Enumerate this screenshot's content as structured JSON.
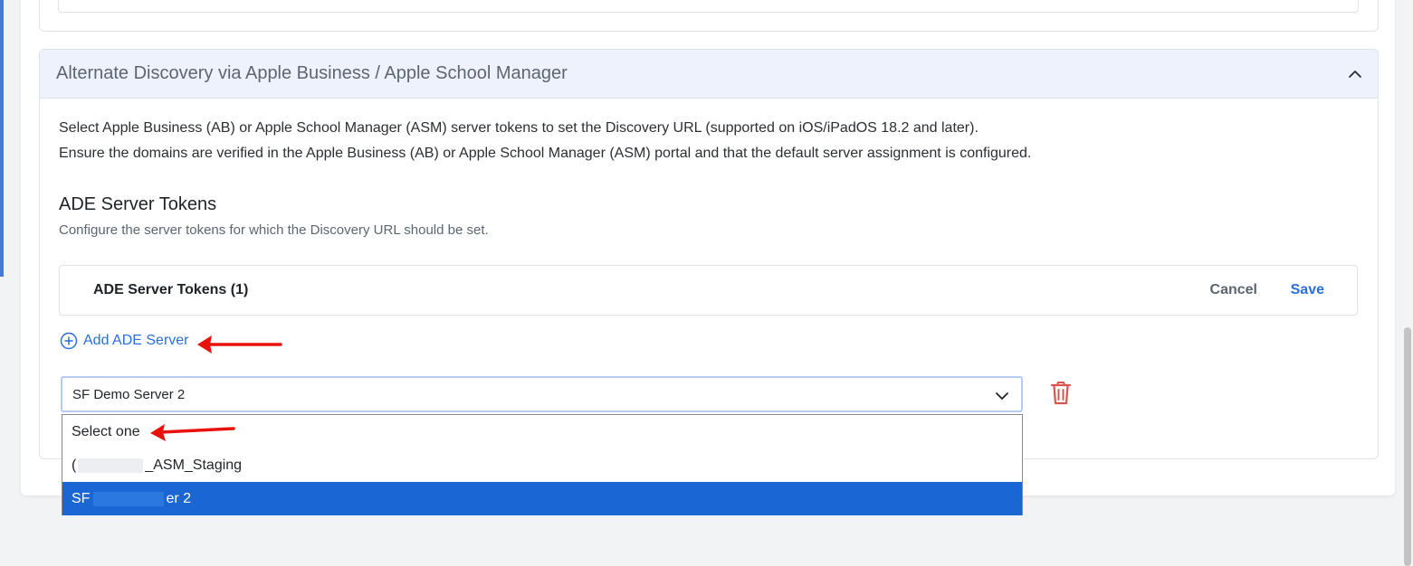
{
  "accordion": {
    "title": "Alternate Discovery via Apple Business / Apple School Manager",
    "description_line1": "Select Apple Business (AB) or Apple School Manager (ASM) server tokens to set the Discovery URL (supported on iOS/iPadOS 18.2 and later).",
    "description_line2": "Ensure the domains are verified in the Apple Business (AB) or Apple School Manager (ASM) portal and that the default server assignment is configured."
  },
  "ade_section": {
    "title": "ADE Server Tokens",
    "subtitle": "Configure the server tokens for which the Discovery URL should be set.",
    "tokens_header": "ADE Server Tokens (1)",
    "cancel_label": "Cancel",
    "save_label": "Save",
    "add_label": "Add ADE Server"
  },
  "select": {
    "value": "SF Demo Server 2",
    "options": [
      {
        "label": "Select one"
      },
      {
        "prefix": "(",
        "suffix": "_ASM_Staging"
      },
      {
        "prefix": "SF",
        "suffix": "er 2"
      }
    ],
    "highlighted_index": 2
  },
  "icons": {
    "accordion_toggle": "chevron-up-icon",
    "select_toggle": "chevron-down-icon",
    "add": "plus-circle-icon",
    "delete": "trash-icon",
    "annotation": "red-arrow-icon"
  },
  "colors": {
    "accent": "#2a6fdb",
    "selected_option": "#1a66d2",
    "danger": "#d9534f",
    "annotation_arrow": "#e8120c",
    "header_bg": "#eef2fc"
  }
}
